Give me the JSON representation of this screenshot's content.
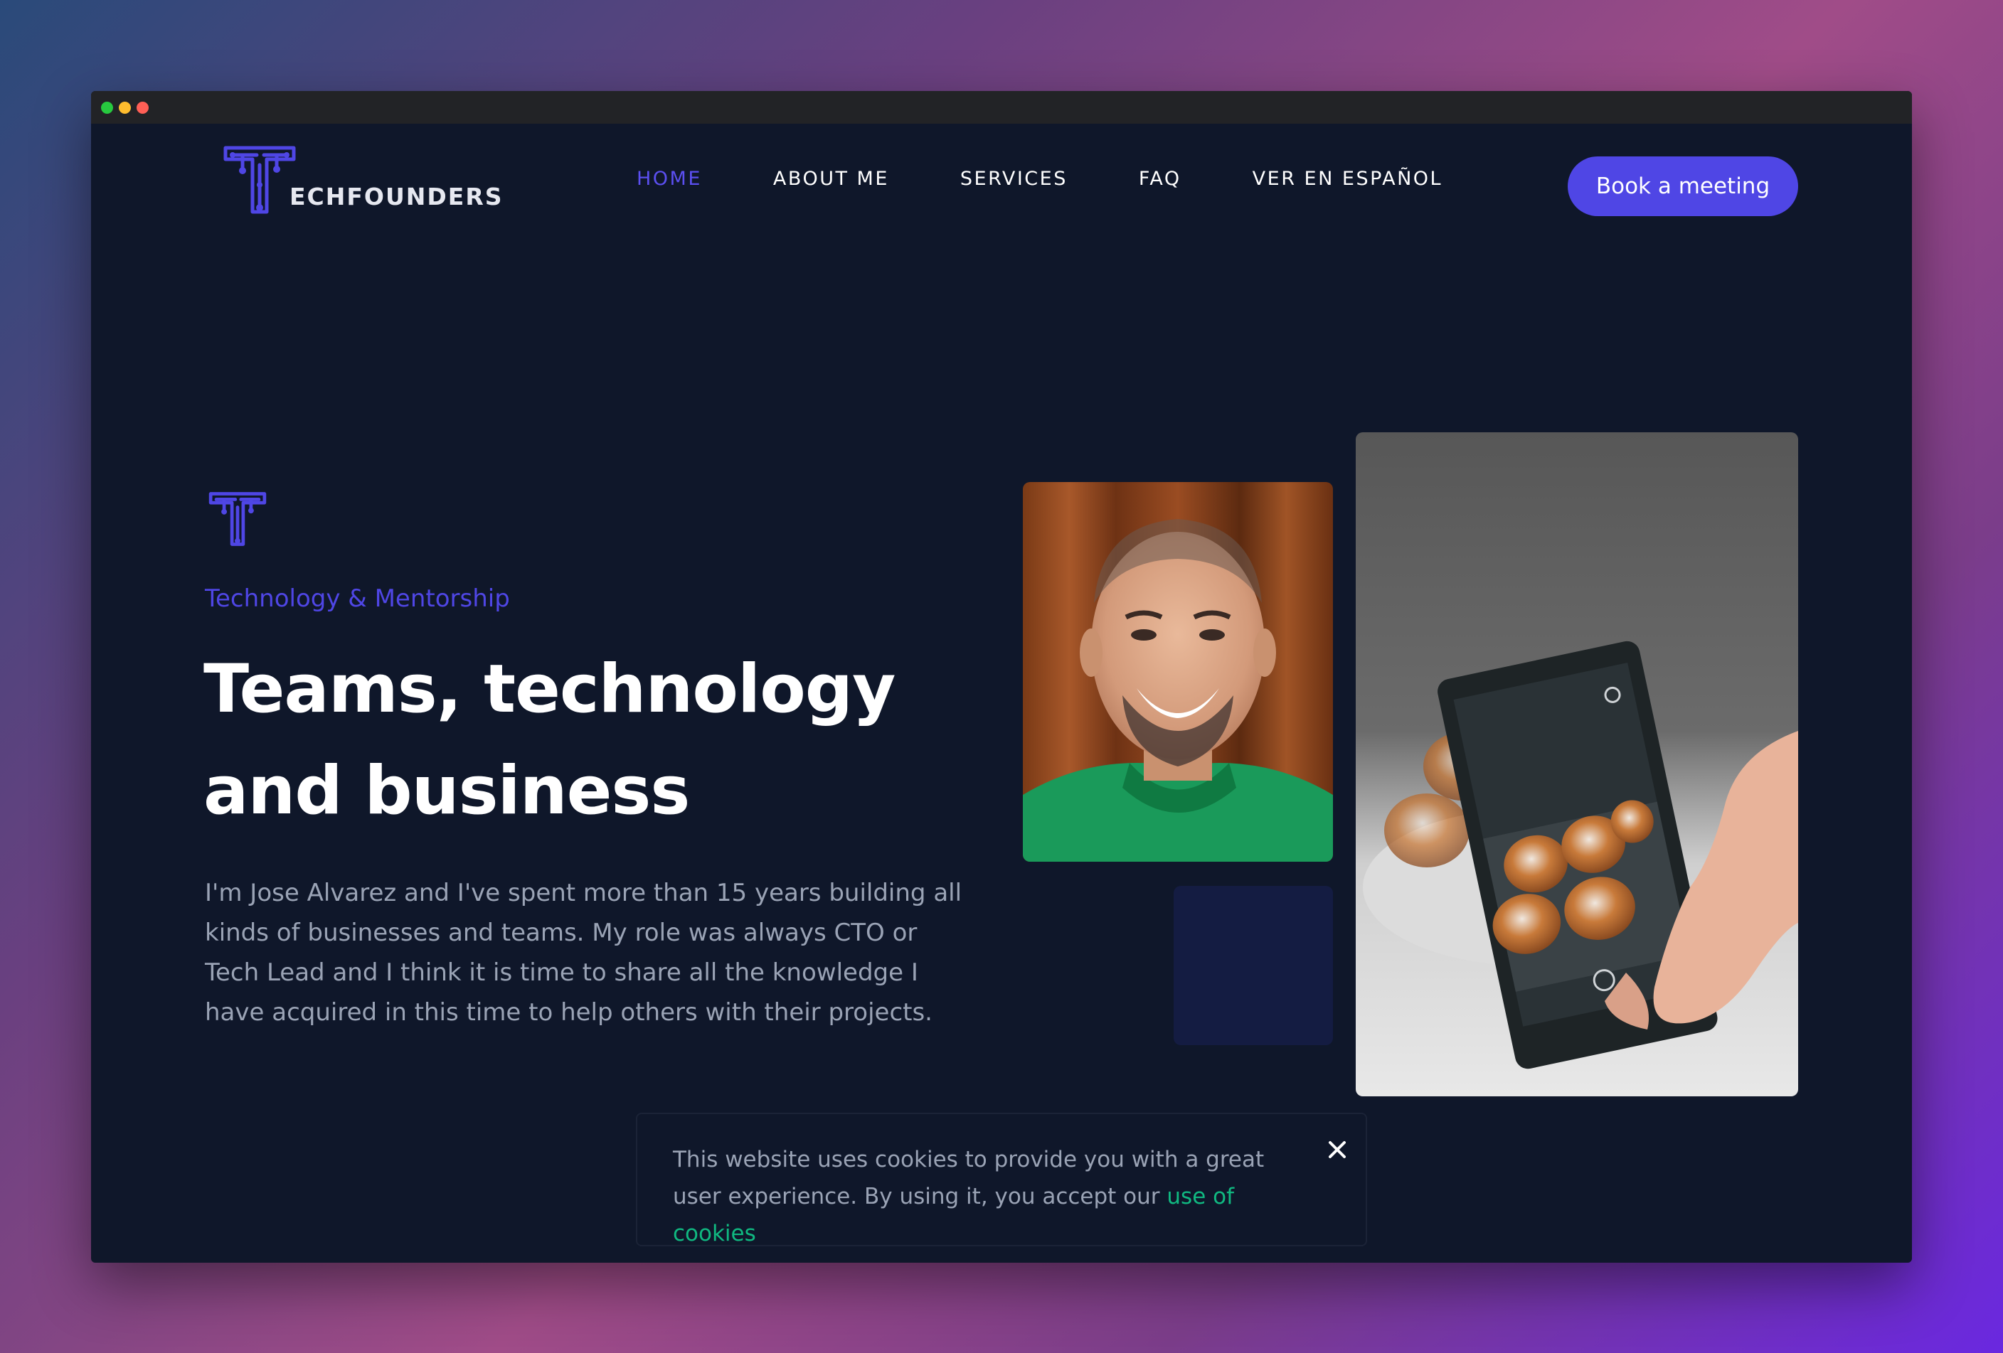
{
  "nav": {
    "logo_text": "ECHFOUNDERS",
    "links": [
      {
        "label": "HOME",
        "active": true
      },
      {
        "label": "ABOUT ME",
        "active": false
      },
      {
        "label": "SERVICES",
        "active": false
      },
      {
        "label": "FAQ",
        "active": false
      },
      {
        "label": "VER EN ESPAÑOL",
        "active": false
      }
    ],
    "cta_label": "Book a meeting"
  },
  "hero": {
    "tagline": "Technology & Mentorship",
    "headline": "Teams, technology and business",
    "intro": "I'm Jose Alvarez and I've spent more than 15 years building all kinds of businesses and teams. My role was always CTO or Tech Lead and I think it is time to share all the knowledge I have acquired in this time to help others with their projects."
  },
  "cookie_banner": {
    "text": "This website uses cookies to provide you with a great user experience. By using it, you accept our ",
    "link_label": "use of cookies"
  },
  "colors": {
    "accent": "#4f46e5",
    "background": "#0f172a",
    "link_green": "#10b981"
  },
  "icons": {
    "logo": "circuit-t-logo-icon",
    "close": "close-icon"
  }
}
